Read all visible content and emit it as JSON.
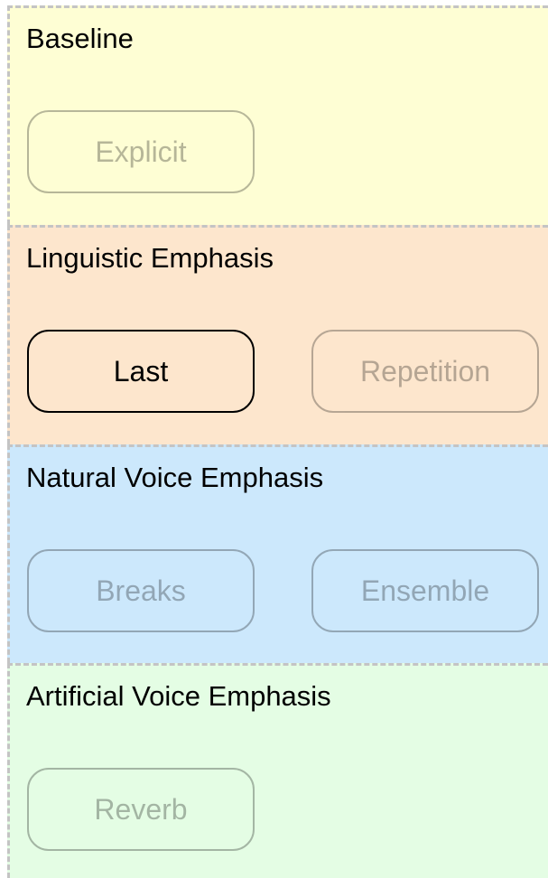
{
  "colors": {
    "border": "#c4c4c4",
    "node_border": "#000000",
    "text": "#000000"
  },
  "groups": [
    {
      "title": "Baseline",
      "fill": "#fefed4",
      "nodes": [
        {
          "label": "Explicit",
          "state": "inactive"
        }
      ]
    },
    {
      "title": "Linguistic Emphasis",
      "fill": "#fde6cd",
      "nodes": [
        {
          "label": "Last",
          "state": "active"
        },
        {
          "label": "Repetition",
          "state": "inactive"
        }
      ]
    },
    {
      "title": "Natural Voice Emphasis",
      "fill": "#cce8fc",
      "nodes": [
        {
          "label": "Breaks",
          "state": "inactive"
        },
        {
          "label": "Ensemble",
          "state": "inactive"
        }
      ]
    },
    {
      "title": "Artificial Voice Emphasis",
      "fill": "#e4fde4",
      "nodes": [
        {
          "label": "Reverb",
          "state": "inactive"
        }
      ]
    }
  ]
}
